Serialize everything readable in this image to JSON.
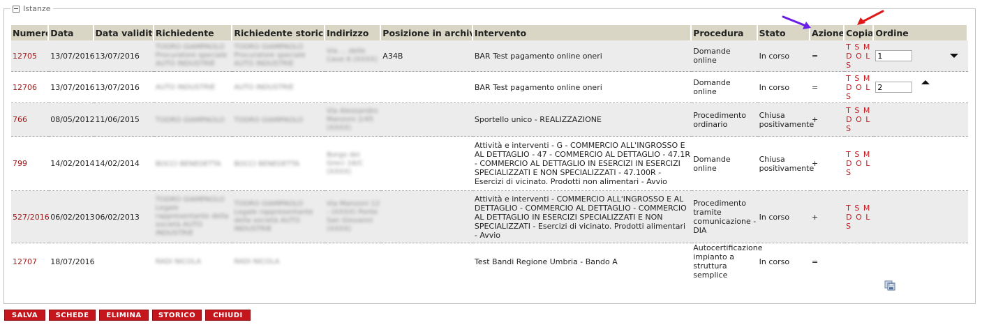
{
  "panel": {
    "legend": "Istanze"
  },
  "columns": [
    "Numero",
    "Data",
    "Data validità",
    "Richiedente",
    "Richiedente storico",
    "Indirizzo",
    "Posizione in archivio",
    "Intervento",
    "Procedura",
    "Stato",
    "Azione",
    "Copia",
    "Ordine"
  ],
  "rows": [
    {
      "numero": "12705",
      "data": "13/07/2016",
      "data_validita": "13/07/2016",
      "richiedente": "TODRO GIAMPAOLO Procuratore speciale AUTO INDUSTRIE",
      "richiedente_storico": "TODRO GIAMPAOLO Procuratore speciale AUTO INDUSTRIE",
      "indirizzo": "Via ... delle Cave 6 (XXXX)",
      "posizione": "A34B",
      "intervento": "BAR Test pagamento online oneri",
      "procedura": "Domande online",
      "stato": "In corso",
      "azione": "=",
      "copia": "T S M D O L S",
      "ordine": "1"
    },
    {
      "numero": "12706",
      "data": "13/07/2016",
      "data_validita": "13/07/2016",
      "richiedente": "AUTO INDUSTRIE",
      "richiedente_storico": "AUTO INDUSTRIE",
      "indirizzo": "",
      "posizione": "",
      "intervento": "BAR Test pagamento online oneri",
      "procedura": "Domande online",
      "stato": "In corso",
      "azione": "=",
      "copia": "T S M D O L S",
      "ordine": "2"
    },
    {
      "numero": "766",
      "data": "08/05/2012",
      "data_validita": "11/06/2015",
      "richiedente": "TODRO GIAMPAOLO",
      "richiedente_storico": "TODRO GIAMPAOLO",
      "indirizzo": "Via Alessandro Manzoni 2/45 (XXXX)",
      "posizione": "",
      "intervento": "Sportello unico - REALIZZAZIONE",
      "procedura": "Procedimento ordinario",
      "stato": "Chiusa positivamente",
      "azione": "+",
      "copia": "T S M D O L S",
      "ordine": ""
    },
    {
      "numero": "799",
      "data": "14/02/2014",
      "data_validita": "14/02/2014",
      "richiedente": "BOCCI BENEDETTA",
      "richiedente_storico": "BOCCI BENEDETTA",
      "indirizzo": "Borgo dei Greci 16/C (XXXX)",
      "posizione": "",
      "intervento": "Attività e interventi - G - COMMERCIO ALL'INGROSSO E AL DETTAGLIO - 47 - COMMERCIO AL DETTAGLIO - 47.1R - COMMERCIO AL DETTAGLIO IN ESERCIZI IN ESERCIZI SPECIALIZZATI E NON SPECIALIZZATI - 47.100R - Esercizi di vicinato. Prodotti non alimentari - Avvio",
      "procedura": "Domande online",
      "stato": "Chiusa positivamente",
      "azione": "+",
      "copia": "T S M D O L S",
      "ordine": ""
    },
    {
      "numero": "527/2016",
      "data": "06/02/2013",
      "data_validita": "06/02/2013",
      "richiedente": "TODRO GIAMPAOLO Legale rappresentante della società AUTO INDUSTRIE",
      "richiedente_storico": "TODRO GIAMPAOLO Legale rappresentante della società AUTO INDUSTRIE",
      "indirizzo": "Via Manzoni 12 - (XXXX) Ponte San Giovanni (XXXX)",
      "posizione": "",
      "intervento": "Attività e interventi - COMMERCIO ALL'INGROSSO E AL DETTAGLIO - COMMERCIO AL DETTAGLIO - COMMERCIO AL DETTAGLIO IN ESERCIZI SPECIALIZZATI E NON SPECIALIZZATI - Esercizi di vicinato. Prodotti alimentari - Avvio",
      "procedura": "Procedimento tramite comunicazione - DIA",
      "stato": "In corso",
      "azione": "+",
      "copia": "T S M D O L S",
      "ordine": ""
    },
    {
      "numero": "12707",
      "data": "18/07/2016",
      "data_validita": "",
      "richiedente": "RADI NICOLA",
      "richiedente_storico": "RADI NICOLA",
      "indirizzo": "",
      "posizione": "",
      "intervento": "Test Bandi Regione Umbria - Bando A",
      "procedura": "Autocertificazione impianto a struttura semplice",
      "stato": "In corso",
      "azione": "=",
      "copia": "",
      "ordine": ""
    }
  ],
  "buttons": {
    "salva": "SALVA",
    "schede": "SCHEDE",
    "elimina": "ELIMINA",
    "storico": "STORICO",
    "chiudi": "CHIUDI"
  },
  "icons": {
    "move_down": "triangle-down-icon",
    "move_up": "triangle-up-icon",
    "bottom": "save-floppy-icon",
    "collapse": "collapse-minus-icon"
  },
  "annotations": {
    "arrow_azione_color": "#6b1ee6",
    "arrow_copia_color": "#e01818"
  },
  "colors": {
    "header_bg": "#d9d6c5",
    "link_red": "#a01a1a",
    "button_red": "#c4161c",
    "row_shade": "#ececec"
  }
}
